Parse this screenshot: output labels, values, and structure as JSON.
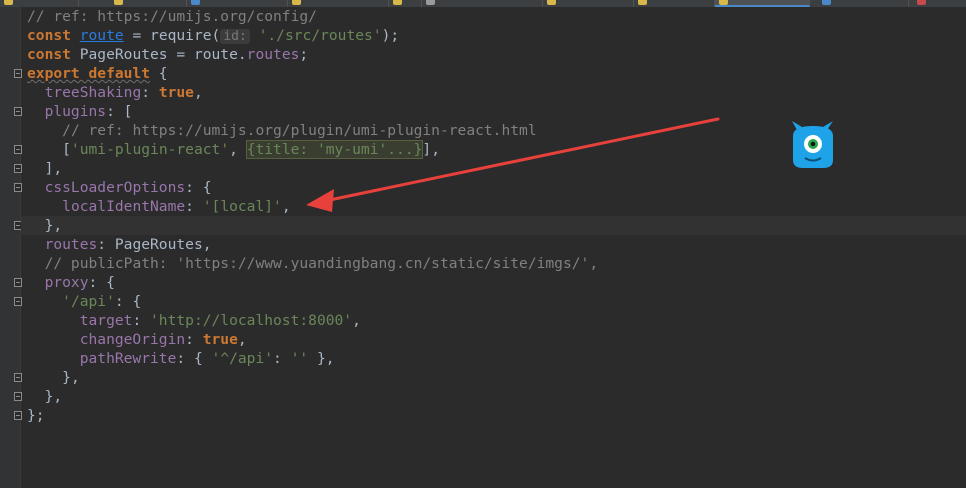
{
  "tabs": [
    {
      "icon": "js-file-icon",
      "color": "#d9b84a"
    },
    {
      "icon": "js-file-icon",
      "color": "#d9b84a"
    },
    {
      "icon": "css-file-icon",
      "color": "#4a88c7"
    },
    {
      "icon": "js-file-icon",
      "color": "#d9b84a"
    },
    {
      "icon": "js-file-icon",
      "color": "#d9b84a"
    },
    {
      "icon": "json-file-icon",
      "color": "#9a9a9a"
    },
    {
      "icon": "js-file-icon",
      "color": "#d9b84a"
    },
    {
      "icon": "js-file-icon",
      "color": "#d9b84a"
    },
    {
      "icon": "js-file-icon",
      "color": "#d9b84a",
      "active": true
    },
    {
      "icon": "css-file-icon",
      "color": "#4a88c7"
    },
    {
      "icon": "close-icon",
      "color": "#c74a4a"
    }
  ],
  "code": {
    "l1": "// ref: https://umijs.org/config/",
    "l2_const": "const",
    "l2_route": "route",
    "l2_mid": " = require(",
    "l2_hint": "id:",
    "l2_str": "'./src/routes'",
    "l2_end": ");",
    "l3_const": "const",
    "l3_rest": " PageRoutes = route.",
    "l3_prop": "routes",
    "l3_end": ";",
    "l4_export": "export default",
    "l4_brace": " {",
    "l5_key": "treeShaking",
    "l5_colon": ": ",
    "l5_val": "true",
    "l5_end": ",",
    "l6_key": "plugins",
    "l6_rest": ": [",
    "l7": "// ref: https://umijs.org/plugin/umi-plugin-react.html",
    "l8_open": "[",
    "l8_str": "'umi-plugin-react'",
    "l8_comma": ", ",
    "l8_fold": "{title: 'my-umi'...}",
    "l8_end": "],",
    "l9": "],",
    "l10_key": "cssLoaderOptions",
    "l10_rest": ": {",
    "l11_key": "localIdentName",
    "l11_colon": ": ",
    "l11_str": "'[local]'",
    "l11_end": ",",
    "l12": "},",
    "l13_key": "routes",
    "l13_rest": ": PageRoutes,",
    "l14": "// publicPath: 'https://www.yuandingbang.cn/static/site/imgs/',",
    "l15_key": "proxy",
    "l15_rest": ": {",
    "l16_str": "'/api'",
    "l16_rest": ": {",
    "l17_key": "target",
    "l17_colon": ": ",
    "l17_str": "'http://localhost:8000'",
    "l17_end": ",",
    "l18_key": "changeOrigin",
    "l18_colon": ": ",
    "l18_val": "true",
    "l18_end": ",",
    "l19_key": "pathRewrite",
    "l19_mid": ": { ",
    "l19_s1": "'^/api'",
    "l19_colon": ": ",
    "l19_s2": "''",
    "l19_end": " },",
    "l20": "},",
    "l21": "},",
    "l22": "};"
  },
  "annotation": {
    "arrow_color": "#e8413c"
  },
  "mascot": {
    "icon": "monster-mascot-icon",
    "color": "#1fa3e8"
  }
}
